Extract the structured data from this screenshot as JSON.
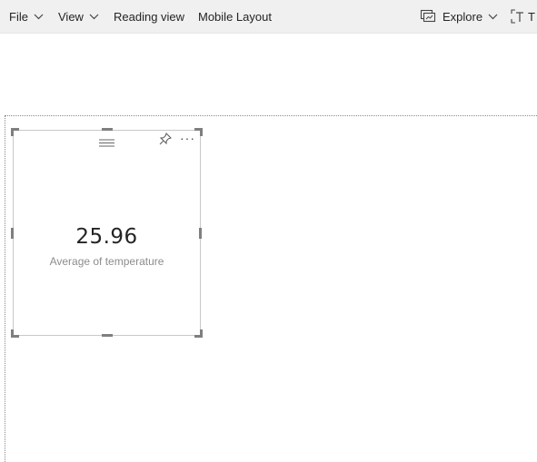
{
  "toolbar": {
    "file_label": "File",
    "view_label": "View",
    "reading_view_label": "Reading view",
    "mobile_layout_label": "Mobile Layout",
    "explore_label": "Explore",
    "text_box_label": "T"
  },
  "visual": {
    "value": "25.96",
    "label": "Average of temperature",
    "icons": [
      "drag-grip-icon",
      "pin-icon",
      "more-options-icon"
    ]
  },
  "colors": {
    "toolbar_bg": "#f0f0f0",
    "handle": "#7f7f7f",
    "label": "#8c8c8c"
  }
}
